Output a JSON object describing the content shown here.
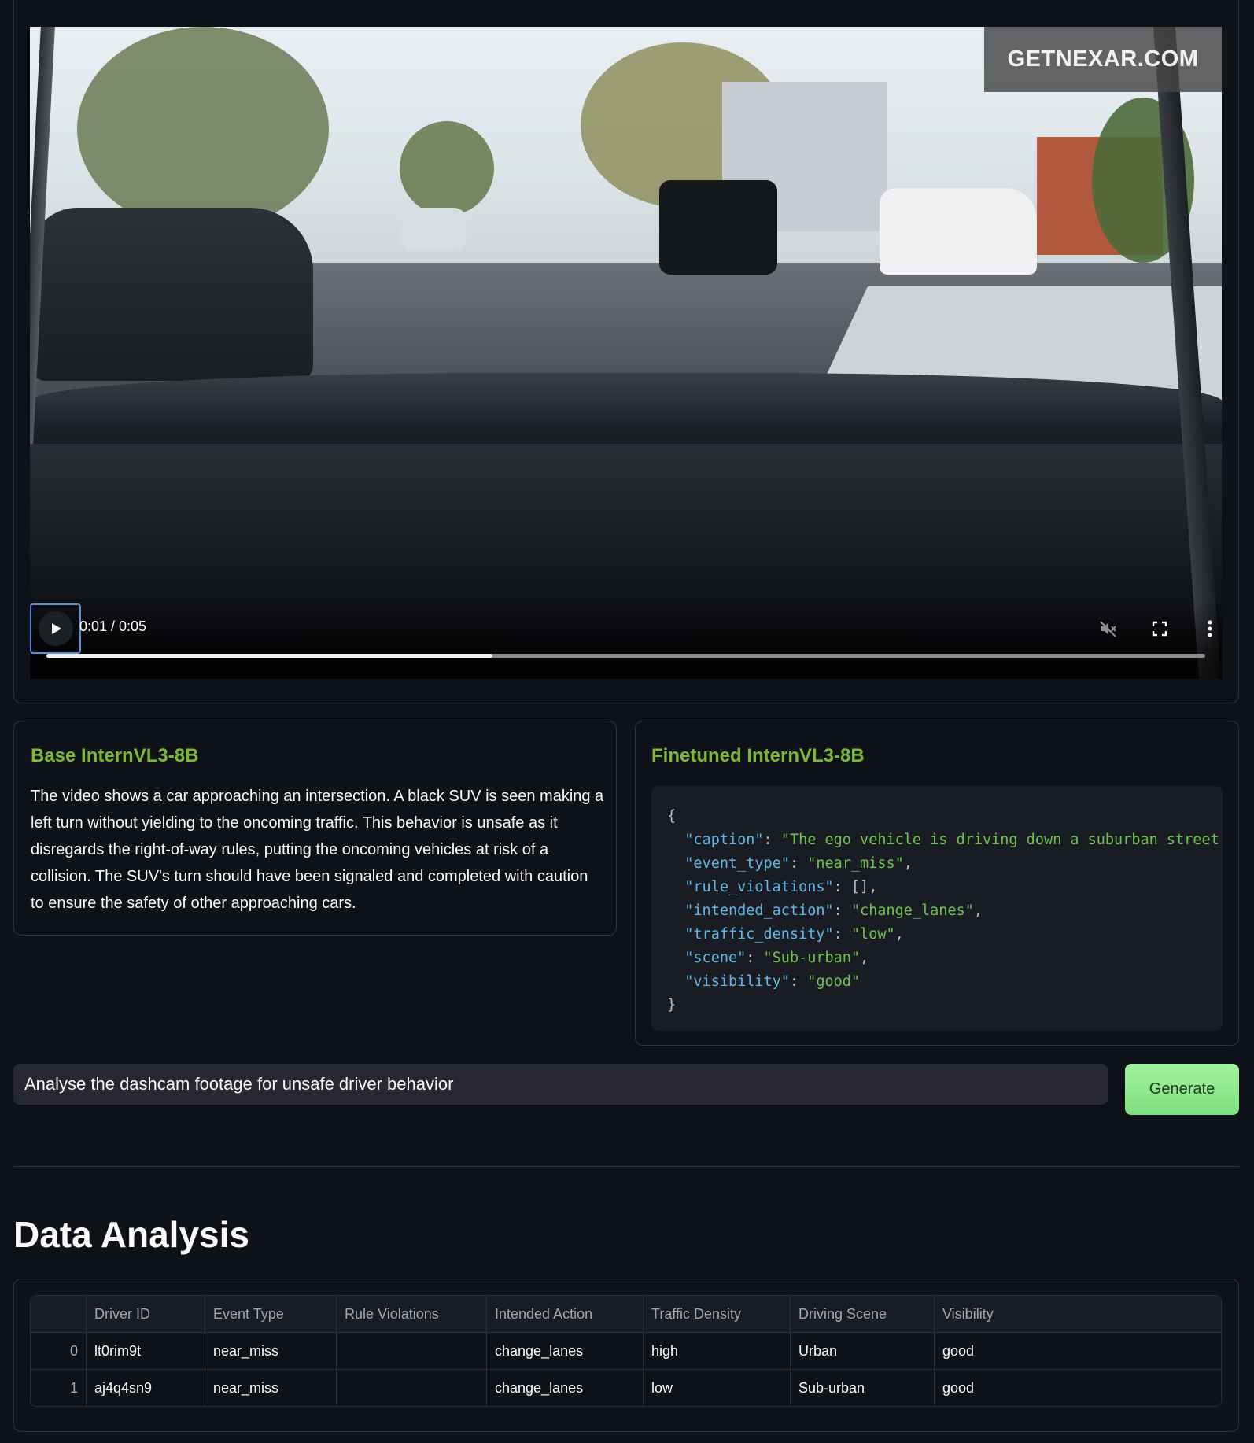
{
  "video": {
    "watermark": "GETNEXAR.COM",
    "time_display": "0:01 / 0:05",
    "progress_fraction": 0.385,
    "icons": [
      "play-icon",
      "mute-icon",
      "fullscreen-icon",
      "more-options-icon"
    ]
  },
  "base_model": {
    "title": "Base InternVL3-8B",
    "output": "The video shows a car approaching an intersection. A black SUV is seen making a left turn without yielding to the oncoming traffic. This behavior is unsafe as it disregards the right-of-way rules, putting the oncoming vehicles at risk of a collision. The SUV's turn should have been signaled and completed with caution to ensure the safety of other approaching cars."
  },
  "finetuned_model": {
    "title": "Finetuned InternVL3-8B",
    "json_output": {
      "open_brace": "{",
      "caption_key": "\"caption\"",
      "caption_val": "\"The ego vehicle is driving down a suburban street",
      "event_type_key": "\"event_type\"",
      "event_type_val": "\"near_miss\"",
      "rule_violations_key": "\"rule_violations\"",
      "rule_violations_val": "[]",
      "intended_action_key": "\"intended_action\"",
      "intended_action_val": "\"change_lanes\"",
      "traffic_density_key": "\"traffic_density\"",
      "traffic_density_val": "\"low\"",
      "scene_key": "\"scene\"",
      "scene_val": "\"Sub-urban\"",
      "visibility_key": "\"visibility\"",
      "visibility_val": "\"good\"",
      "close_brace": "}"
    }
  },
  "prompt": {
    "value": "Analyse the dashcam footage for unsafe driver behavior",
    "button_label": "Generate"
  },
  "analysis": {
    "title": "Data Analysis",
    "columns": [
      "",
      "Driver ID",
      "Event Type",
      "Rule Violations",
      "Intended Action",
      "Traffic Density",
      "Driving Scene",
      "Visibility"
    ],
    "rows": [
      {
        "index": "0",
        "driver_id": "lt0rim9t",
        "event_type": "near_miss",
        "rule_violations": "",
        "intended_action": "change_lanes",
        "traffic_density": "high",
        "driving_scene": "Urban",
        "visibility": "good"
      },
      {
        "index": "1",
        "driver_id": "aj4q4sn9",
        "event_type": "near_miss",
        "rule_violations": "",
        "intended_action": "change_lanes",
        "traffic_density": "low",
        "driving_scene": "Sub-urban",
        "visibility": "good"
      }
    ]
  },
  "colors": {
    "background": "#0e1117",
    "accent_title": "#7db92e",
    "button": "#a3f0a0",
    "json_key": "#5db8e8",
    "json_string": "#6cc24a"
  }
}
